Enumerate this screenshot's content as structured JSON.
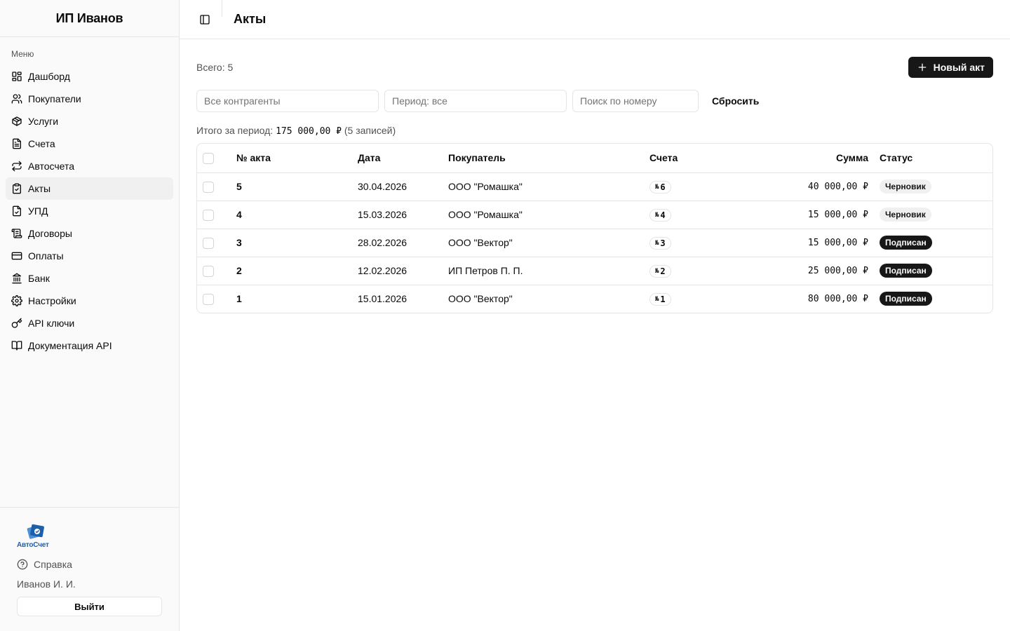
{
  "sidebar": {
    "title": "ИП Иванов",
    "group_label": "Меню",
    "items": [
      {
        "label": "Дашборд",
        "icon": "dashboard-icon"
      },
      {
        "label": "Покупатели",
        "icon": "users-icon"
      },
      {
        "label": "Услуги",
        "icon": "package-icon"
      },
      {
        "label": "Счета",
        "icon": "file-text-icon"
      },
      {
        "label": "Автосчета",
        "icon": "repeat-icon"
      },
      {
        "label": "Акты",
        "icon": "clipboard-check-icon",
        "active": true
      },
      {
        "label": "УПД",
        "icon": "file-check-icon"
      },
      {
        "label": "Договоры",
        "icon": "scroll-icon"
      },
      {
        "label": "Оплаты",
        "icon": "credit-card-icon"
      },
      {
        "label": "Банк",
        "icon": "landmark-icon"
      },
      {
        "label": "Настройки",
        "icon": "settings-icon"
      },
      {
        "label": "API ключи",
        "icon": "key-icon"
      },
      {
        "label": "Документация API",
        "icon": "book-open-icon"
      }
    ],
    "footer": {
      "logo_text": "АвтоСчет",
      "help_label": "Справка",
      "user_name": "Иванов И. И.",
      "logout_label": "Выйти"
    }
  },
  "header": {
    "title": "Акты"
  },
  "toolbar": {
    "total_label": "Всего: 5",
    "new_button_label": "Новый акт"
  },
  "filters": {
    "counterparty_placeholder": "Все контрагенты",
    "period_placeholder": "Период: все",
    "search_placeholder": "Поиск по номеру",
    "reset_label": "Сбросить"
  },
  "summary": {
    "prefix": "Итого за период:",
    "amount": "175 000,00 ₽",
    "count": "(5 записей)"
  },
  "table": {
    "columns": [
      "№ акта",
      "Дата",
      "Покупатель",
      "Счета",
      "Сумма",
      "Статус"
    ],
    "rows": [
      {
        "num": "5",
        "date": "30.04.2026",
        "buyer": "ООО \"Ромашка\"",
        "invoice": "6",
        "sum": "40 000,00 ₽",
        "status": "Черновик",
        "status_kind": "draft"
      },
      {
        "num": "4",
        "date": "15.03.2026",
        "buyer": "ООО \"Ромашка\"",
        "invoice": "4",
        "sum": "15 000,00 ₽",
        "status": "Черновик",
        "status_kind": "draft"
      },
      {
        "num": "3",
        "date": "28.02.2026",
        "buyer": "ООО \"Вектор\"",
        "invoice": "3",
        "sum": "15 000,00 ₽",
        "status": "Подписан",
        "status_kind": "signed"
      },
      {
        "num": "2",
        "date": "12.02.2026",
        "buyer": "ИП Петров П. П.",
        "invoice": "2",
        "sum": "25 000,00 ₽",
        "status": "Подписан",
        "status_kind": "signed"
      },
      {
        "num": "1",
        "date": "15.01.2026",
        "buyer": "ООО \"Вектор\"",
        "invoice": "1",
        "sum": "80 000,00 ₽",
        "status": "Подписан",
        "status_kind": "signed"
      }
    ]
  },
  "colors": {
    "primary": "#171717",
    "border": "#e5e5e5",
    "sidebar_bg": "#fafafa",
    "logo": "#1d5fa8"
  }
}
